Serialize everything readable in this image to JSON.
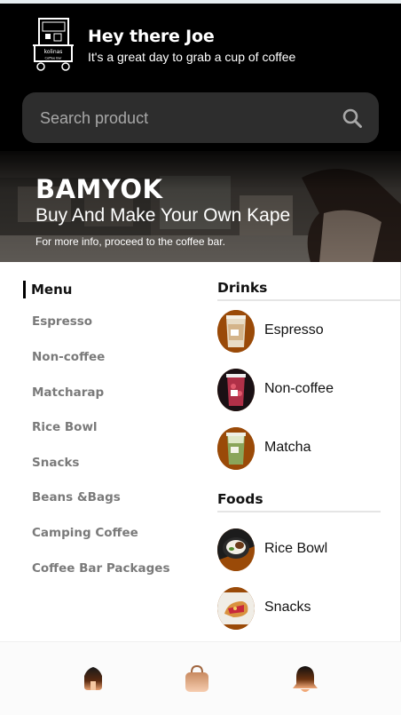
{
  "header": {
    "greeting_title": "Hey there Joe",
    "greeting_sub": "It's a great day to grab a cup of coffee",
    "logo_text": "kolinas",
    "logo_subtext": "Coffee Bar"
  },
  "search": {
    "placeholder": "Search product"
  },
  "banner": {
    "title": "BAMYOK",
    "subtitle": "Buy And Make Your Own Kape",
    "note": "For more info, proceed to the coffee bar."
  },
  "menu": {
    "heading": "Menu",
    "items": [
      {
        "label": "Espresso"
      },
      {
        "label": "Non-coffee"
      },
      {
        "label": "Matcharap"
      },
      {
        "label": "Rice Bowl"
      },
      {
        "label": "Snacks"
      },
      {
        "label": "Beans &Bags"
      },
      {
        "label": "Camping Coffee"
      },
      {
        "label": "Coffee Bar Packages"
      }
    ]
  },
  "drinks": {
    "heading": "Drinks",
    "items": [
      {
        "label": "Espresso"
      },
      {
        "label": "Non-coffee"
      },
      {
        "label": "Matcha"
      }
    ]
  },
  "foods": {
    "heading": "Foods",
    "items": [
      {
        "label": "Rice Bowl"
      },
      {
        "label": "Snacks"
      }
    ]
  },
  "colors": {
    "brand_brown": "#9a4a08",
    "header_bg": "#000000",
    "search_bg": "#2d2d2d"
  },
  "nav": {
    "icons": [
      "home-icon",
      "shopping-bag-icon",
      "bell-icon"
    ]
  }
}
